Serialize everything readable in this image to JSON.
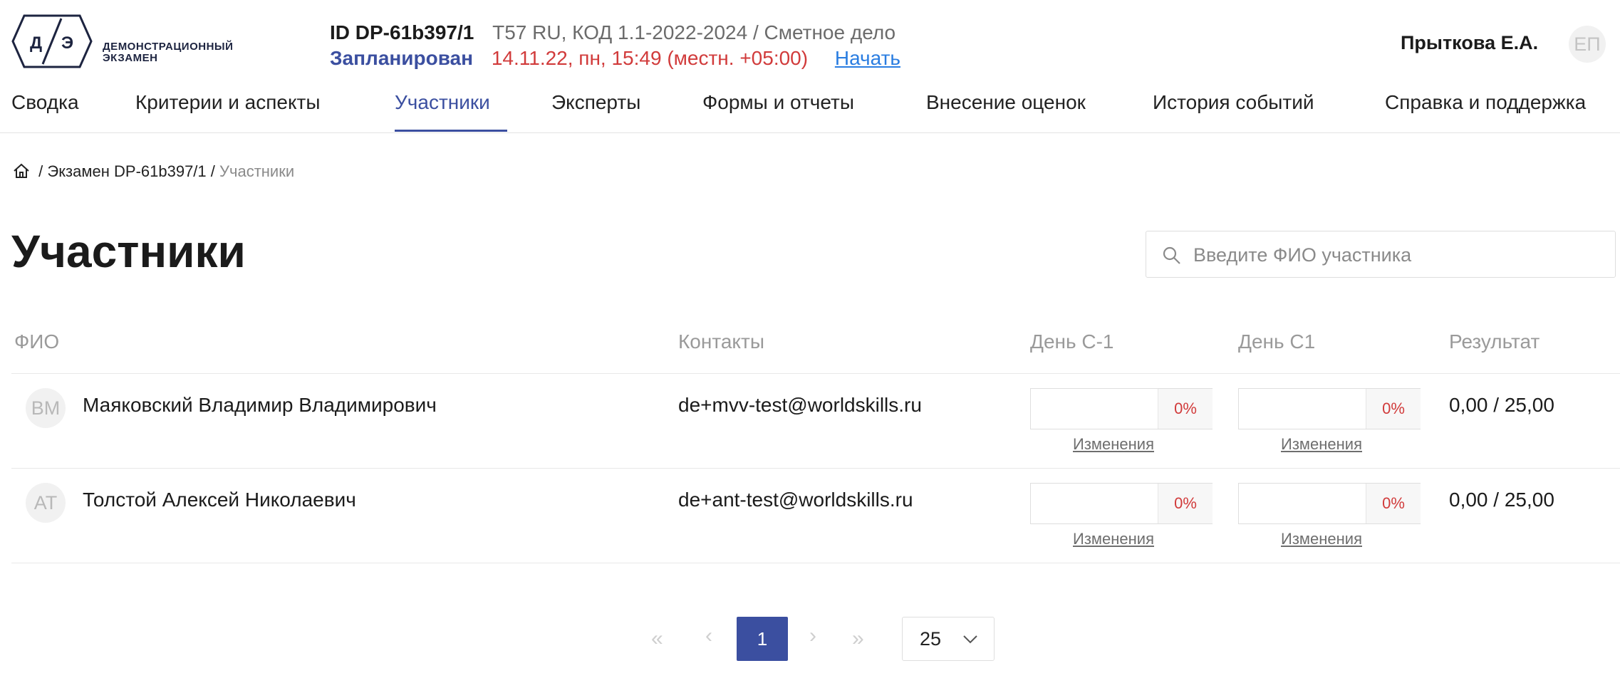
{
  "header": {
    "logo_text": "ДЕМОНСТРАЦИОННЫЙ ЭКЗАМЕН",
    "exam_id": "ID DP-61b397/1",
    "exam_meta": "T57 RU, КОД 1.1-2022-2024 / Сметное дело",
    "status": "Запланирован",
    "datetime": "14.11.22, пн, 15:49 (местн. +05:00)",
    "start_label": "Начать",
    "user_name": "Прыткова Е.А.",
    "user_initials": "ЕП"
  },
  "nav": {
    "items": [
      {
        "label": "Сводка"
      },
      {
        "label": "Критерии и аспекты"
      },
      {
        "label": "Участники"
      },
      {
        "label": "Эксперты"
      },
      {
        "label": "Формы и отчеты"
      },
      {
        "label": "Внесение оценок"
      },
      {
        "label": "История событий"
      },
      {
        "label": "Справка и поддержка"
      }
    ],
    "active_index": 2
  },
  "breadcrumb": {
    "separator": "/",
    "exam": "Экзамен DP-61b397/1",
    "current": "Участники"
  },
  "page": {
    "title": "Участники",
    "search_placeholder": "Введите ФИО участника"
  },
  "table": {
    "columns": [
      "ФИО",
      "Контакты",
      "День С-1",
      "День С1",
      "Результат"
    ],
    "rows": [
      {
        "initials": "ВМ",
        "name": "Маяковский Владимир Владимирович",
        "contact": "de+mvv-test@worldskills.ru",
        "day_c_minus1_pct": "0%",
        "day_c1_pct": "0%",
        "changes_label": "Изменения",
        "result": "0,00 / 25,00"
      },
      {
        "initials": "АТ",
        "name": "Толстой Алексей Николаевич",
        "contact": "de+ant-test@worldskills.ru",
        "day_c_minus1_pct": "0%",
        "day_c1_pct": "0%",
        "changes_label": "Изменения",
        "result": "0,00 / 25,00"
      }
    ]
  },
  "pagination": {
    "first": "«",
    "prev": "‹",
    "current_page": "1",
    "next": "›",
    "last": "»",
    "page_size": "25"
  },
  "colors": {
    "accent": "#3b4fa0",
    "danger": "#d13b3b",
    "link": "#2a7de1"
  }
}
